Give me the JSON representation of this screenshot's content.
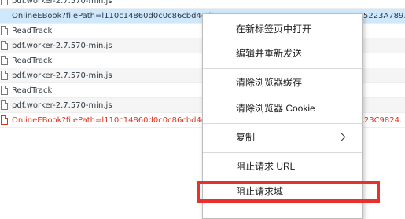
{
  "requests": [
    {
      "name": "pdf.worker-2.7.570-min.js",
      "tail": "",
      "state": "normal"
    },
    {
      "name": "OnlineEBook?filePath=l110c14860d0c0c86cbd4edb",
      "tail": "5223A789...",
      "state": "selected"
    },
    {
      "name": "ReadTrack",
      "tail": "",
      "state": "normal"
    },
    {
      "name": "pdf.worker-2.7.570-min.js",
      "tail": "",
      "state": "normal"
    },
    {
      "name": "ReadTrack",
      "tail": "",
      "state": "normal"
    },
    {
      "name": "pdf.worker-2.7.570-min.js",
      "tail": "",
      "state": "normal"
    },
    {
      "name": "ReadTrack",
      "tail": "",
      "state": "normal"
    },
    {
      "name": "pdf.worker-2.7.570-min.js",
      "tail": "",
      "state": "normal"
    },
    {
      "name": "OnlineEBook?filePath=l110c14860d0c0c86cbd4edb",
      "tail": "A23C9824...",
      "state": "error"
    }
  ],
  "context_menu": {
    "items": [
      {
        "label": "在新标签页中打开",
        "submenu": false
      },
      {
        "label": "编辑并重新发送",
        "submenu": false
      },
      {
        "label": "清除浏览器缓存",
        "submenu": false
      },
      {
        "label": "清除浏览器 Cookie",
        "submenu": false
      },
      {
        "label": "复制",
        "submenu": true
      },
      {
        "label": "阻止请求 URL",
        "submenu": false
      },
      {
        "label": "阻止请求域",
        "submenu": false,
        "highlighted": true
      }
    ]
  },
  "colors": {
    "error_text": "#e1321e",
    "selected_row": "#cfe8fc",
    "highlight_border": "#e8302d"
  }
}
